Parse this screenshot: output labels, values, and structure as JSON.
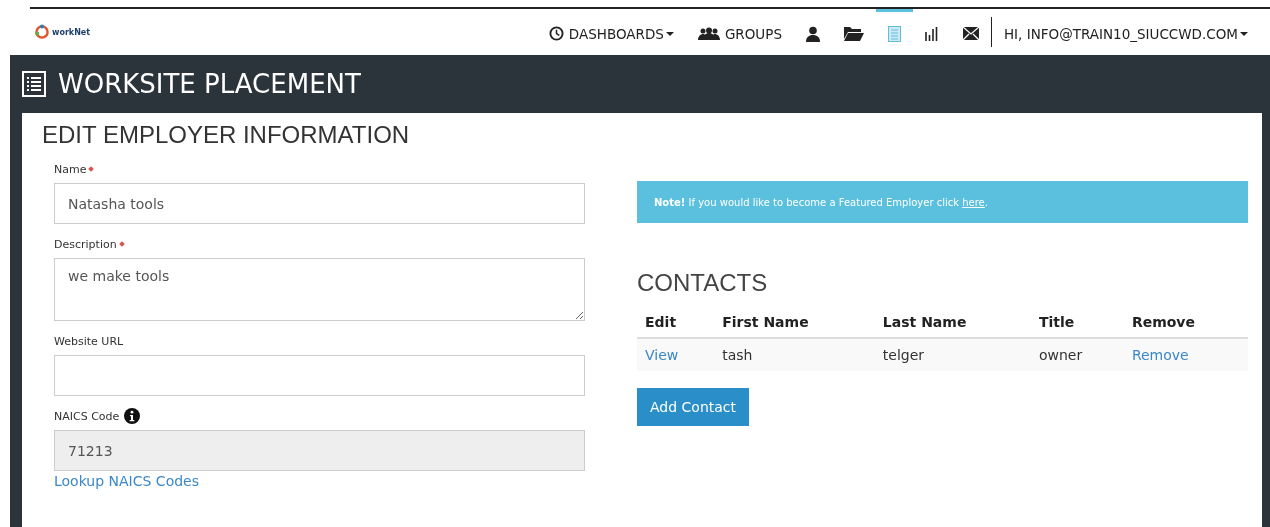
{
  "logo": {
    "text": "workNet"
  },
  "nav": [
    {
      "kind": "menu",
      "label": "DASHBOARDS",
      "selected": false
    },
    {
      "kind": "link",
      "label": "GROUPS",
      "selected": false
    },
    {
      "kind": "icon",
      "selected": false
    },
    {
      "kind": "icon",
      "selected": false
    },
    {
      "kind": "icon",
      "selected": true
    },
    {
      "kind": "icon",
      "selected": false
    },
    {
      "kind": "icon",
      "selected": false
    },
    {
      "kind": "menu",
      "label": "HI, INFO@TRAIN10_SIUCCWD.COM",
      "selected": false
    }
  ],
  "page_title": "WORKSITE PLACEMENT",
  "section_title": "EDIT EMPLOYER INFORMATION",
  "fields": [
    {
      "kind": "input",
      "label": "Name",
      "required": true,
      "value": "Natasha tools",
      "disabled": false
    },
    {
      "kind": "textarea",
      "label": "Description",
      "required": true,
      "value": "we make tools",
      "disabled": false
    },
    {
      "kind": "input",
      "label": "Website URL",
      "required": false,
      "disabled": false
    },
    {
      "kind": "input",
      "label": "NAICS Code",
      "required": false,
      "info": true,
      "value": "71213",
      "disabled": true
    }
  ],
  "lookup_link": "Lookup NAICS Codes",
  "note": {
    "text": "**Note!** If you would like to become a Featured Employer click ",
    "link": "here",
    "end": "."
  },
  "contacts": {
    "title": "CONTACTS",
    "columns": [
      "Edit",
      "First Name",
      "Last Name",
      "Title",
      "Remove"
    ],
    "rows": [
      {
        "edit": "View",
        "first_name": "tash",
        "last_name": "telger",
        "title": "owner",
        "remove": "Remove"
      }
    ],
    "add_button": "Add Contact"
  }
}
